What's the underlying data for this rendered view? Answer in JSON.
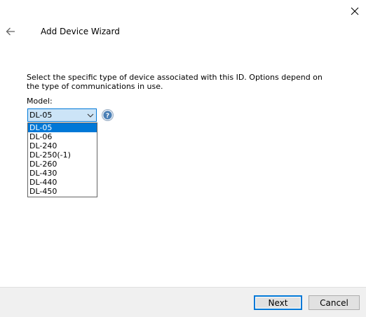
{
  "window": {
    "title": "Add Device Wizard"
  },
  "icons": {
    "close": "close-icon",
    "back": "back-arrow-icon",
    "help": "help-icon",
    "chevron": "chevron-down-icon"
  },
  "form": {
    "instructions": "Select the specific type of device associated with this ID. Options depend on the type of communications in use.",
    "model_label": "Model:",
    "model_selected": "DL-05",
    "model_options": [
      "DL-05",
      "DL-06",
      "DL-240",
      "DL-250(-1)",
      "DL-260",
      "DL-430",
      "DL-440",
      "DL-450"
    ],
    "highlighted_option_index": 0
  },
  "footer": {
    "next_label": "Next",
    "cancel_label": "Cancel"
  },
  "colors": {
    "accent": "#0078d7",
    "select_bg": "#cce4f7",
    "footer_bg": "#f0f0f0",
    "help_icon": "#4a7fb5"
  }
}
